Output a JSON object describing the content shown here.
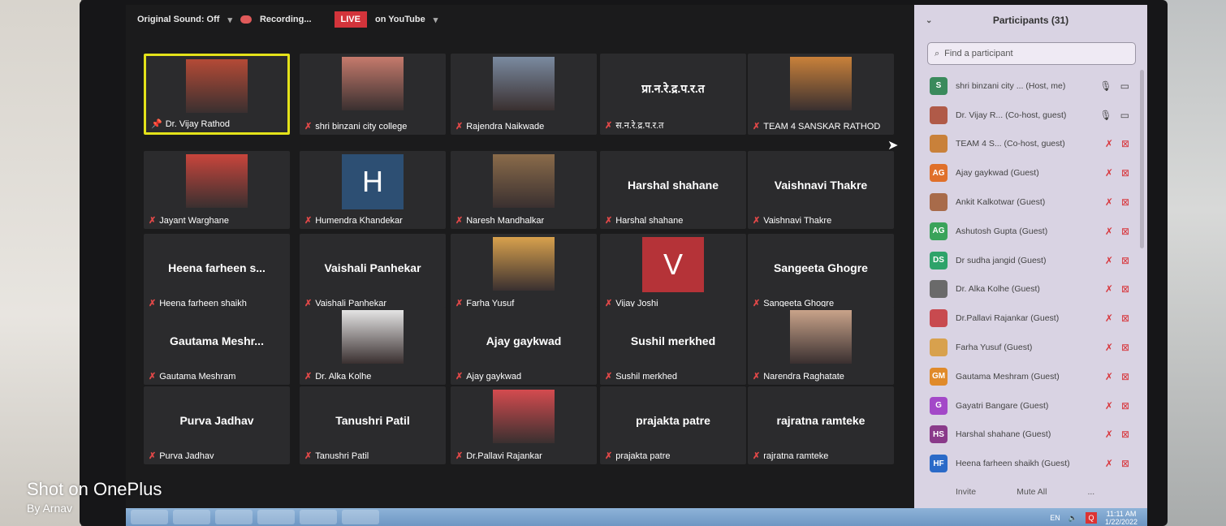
{
  "topbar": {
    "original_sound": "Original Sound: Off",
    "recording": "Recording...",
    "live_badge": "LIVE",
    "live_platform": "on YouTube"
  },
  "tiles": [
    {
      "name": "Dr. Vijay Rathod",
      "center": "",
      "kind": "photo",
      "active": true,
      "pinned": true,
      "color": "#b44a36"
    },
    {
      "name": "shri binzani city college",
      "center": "",
      "kind": "photo",
      "color": "#c57a6c"
    },
    {
      "name": "Rajendra Naikwade",
      "center": "",
      "kind": "photo",
      "color": "#7a8aa0"
    },
    {
      "name": "स.न.रे.द्र.प.र.त",
      "center": "प्रा.न.रे.द्र.प.र.त",
      "kind": "text"
    },
    {
      "name": "TEAM 4 SANSKAR RATHOD",
      "center": "",
      "kind": "photo",
      "color": "#c9813a"
    },
    {
      "name": "Jayant Warghane",
      "center": "",
      "kind": "photo",
      "color": "#c8453c"
    },
    {
      "name": "Humendra Khandekar",
      "center": "",
      "kind": "letter",
      "letter": "H",
      "color": "#2d4f73"
    },
    {
      "name": "Naresh Mandhalkar",
      "center": "",
      "kind": "photo",
      "color": "#8a6b4a"
    },
    {
      "name": "Harshal shahane",
      "center": "Harshal shahane",
      "kind": "text"
    },
    {
      "name": "Vaishnavi Thakre",
      "center": "Vaishnavi Thakre",
      "kind": "text"
    },
    {
      "name": "Heena farheen shaikh",
      "center": "Heena farheen s...",
      "kind": "text"
    },
    {
      "name": "Vaishali Panhekar",
      "center": "Vaishali Panhekar",
      "kind": "text"
    },
    {
      "name": "Farha Yusuf",
      "center": "",
      "kind": "photo",
      "color": "#d8a14d"
    },
    {
      "name": "Vijay Joshi",
      "center": "",
      "kind": "letter",
      "letter": "V",
      "color": "#b53338"
    },
    {
      "name": "Sangeeta Ghogre",
      "center": "Sangeeta Ghogre",
      "kind": "text"
    },
    {
      "name": "Gautama Meshram",
      "center": "Gautama Meshr...",
      "kind": "text"
    },
    {
      "name": "Dr. Alka Kolhe",
      "center": "",
      "kind": "photo",
      "color": "#e4e4e4"
    },
    {
      "name": "Ajay gaykwad",
      "center": "Ajay gaykwad",
      "kind": "text"
    },
    {
      "name": "Sushil merkhed",
      "center": "Sushil merkhed",
      "kind": "text"
    },
    {
      "name": "Narendra Raghatate",
      "center": "",
      "kind": "photo",
      "color": "#c9a38a"
    },
    {
      "name": "Purva Jadhav",
      "center": "Purva Jadhav",
      "kind": "text"
    },
    {
      "name": "Tanushri Patil",
      "center": "Tanushri Patil",
      "kind": "text"
    },
    {
      "name": "Dr.Pallavi Rajankar",
      "center": "",
      "kind": "photo",
      "color": "#d44b4f"
    },
    {
      "name": "prajakta patre",
      "center": "prajakta patre",
      "kind": "text"
    },
    {
      "name": "rajratna ramteke",
      "center": "rajratna ramteke",
      "kind": "text"
    }
  ],
  "panel": {
    "title": "Participants (31)",
    "search_placeholder": "Find a participant",
    "invite": "Invite",
    "mute_all": "Mute All",
    "more": "...",
    "participants": [
      {
        "initials": "S",
        "name": "shri binzani city ... (Host, me)",
        "color": "#3a8a5c",
        "muted": false
      },
      {
        "initials": "",
        "name": "Dr. Vijay R... (Co-host, guest)",
        "color": "#b05a48",
        "muted": false
      },
      {
        "initials": "",
        "name": "TEAM 4 S... (Co-host, guest)",
        "color": "#c9813a",
        "muted": true
      },
      {
        "initials": "AG",
        "name": "Ajay gaykwad (Guest)",
        "color": "#e0702a",
        "muted": true
      },
      {
        "initials": "",
        "name": "Ankit Kalkotwar (Guest)",
        "color": "#a86b4a",
        "muted": true
      },
      {
        "initials": "AG",
        "name": "Ashutosh Gupta (Guest)",
        "color": "#3aa35a",
        "muted": true
      },
      {
        "initials": "DS",
        "name": "Dr sudha jangid (Guest)",
        "color": "#2ea36a",
        "muted": true
      },
      {
        "initials": "",
        "name": "Dr. Alka Kolhe (Guest)",
        "color": "#6a6a6a",
        "muted": true
      },
      {
        "initials": "",
        "name": "Dr.Pallavi Rajankar (Guest)",
        "color": "#c84a4f",
        "muted": true
      },
      {
        "initials": "",
        "name": "Farha Yusuf (Guest)",
        "color": "#d8a14d",
        "muted": true
      },
      {
        "initials": "GM",
        "name": "Gautama Meshram (Guest)",
        "color": "#e08a2a",
        "muted": true
      },
      {
        "initials": "G",
        "name": "Gayatri Bangare (Guest)",
        "color": "#a348c8",
        "muted": true
      },
      {
        "initials": "HS",
        "name": "Harshal shahane (Guest)",
        "color": "#8a3a8a",
        "muted": true
      },
      {
        "initials": "HF",
        "name": "Heena farheen shaikh (Guest)",
        "color": "#2a6ac8",
        "muted": true
      }
    ]
  },
  "taskbar": {
    "lang": "EN",
    "time": "11:11 AM",
    "date": "1/22/2022"
  },
  "watermark": {
    "line1": "Shot on OnePlus",
    "line2": "By Arnav"
  },
  "icons": {
    "mute": "mic-off-icon",
    "pin": "pin-icon",
    "search": "search-icon"
  }
}
